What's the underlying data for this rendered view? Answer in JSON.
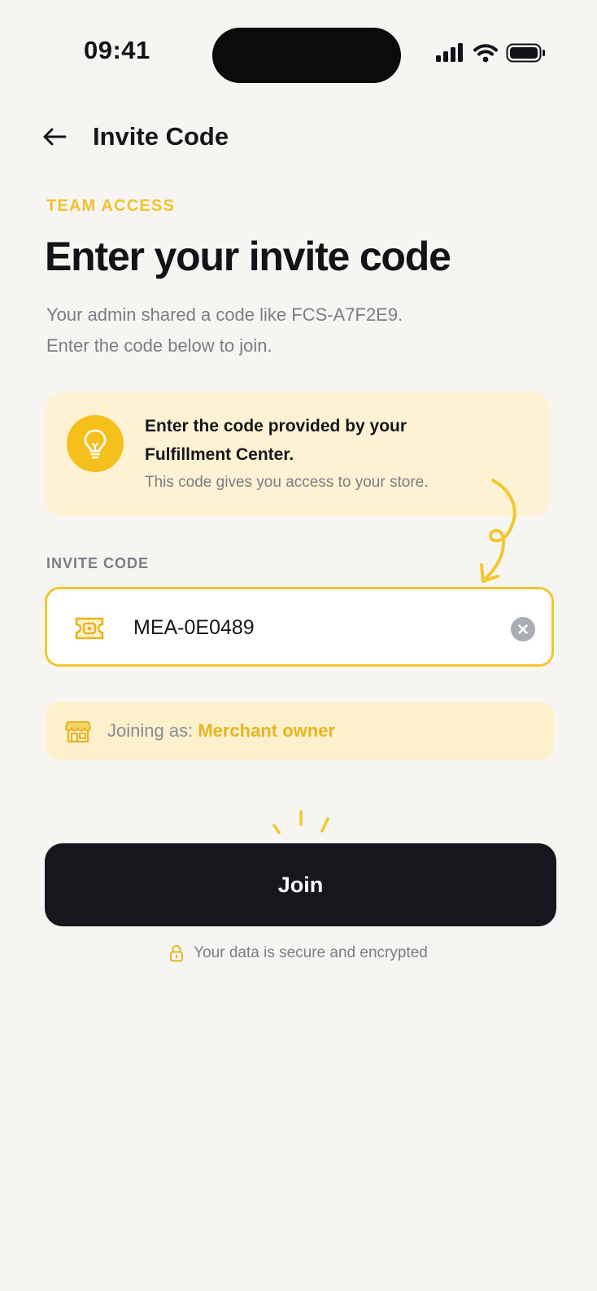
{
  "status_bar": {
    "time": "09:41",
    "icons": [
      "signal-icon",
      "wifi-icon",
      "battery-icon"
    ]
  },
  "header": {
    "back_icon": "arrow-left-icon",
    "title": "Invite Code"
  },
  "eyebrow": "TEAM ACCESS",
  "page_title": "Enter your invite code",
  "subtitle": {
    "line1": "Your admin shared a code like FCS-A7F2E9.",
    "line2": "Enter the code below to join."
  },
  "info_card": {
    "icon": "lightbulb-icon",
    "title_line1": "Enter the code provided by your",
    "title_line2": "Fulfillment Center.",
    "subtitle": "This code gives you access to your store."
  },
  "invite_field": {
    "label": "INVITE CODE",
    "value": "MEA-0E0489",
    "icon": "ticket-icon",
    "clear_icon": "clear-icon"
  },
  "role_banner": {
    "icon": "store-icon",
    "prefix": "Joining as:",
    "role": "Merchant owner"
  },
  "join_button": {
    "label": "Join"
  },
  "secure_note": {
    "icon": "lock-icon",
    "text": "Your data is secure and encrypted"
  },
  "colors": {
    "accent": "#f3c62d",
    "background": "#f6f5f2",
    "info_card_bg": "#fdf2d3",
    "button_bg": "#15171d",
    "muted_text": "#7a7d84"
  }
}
